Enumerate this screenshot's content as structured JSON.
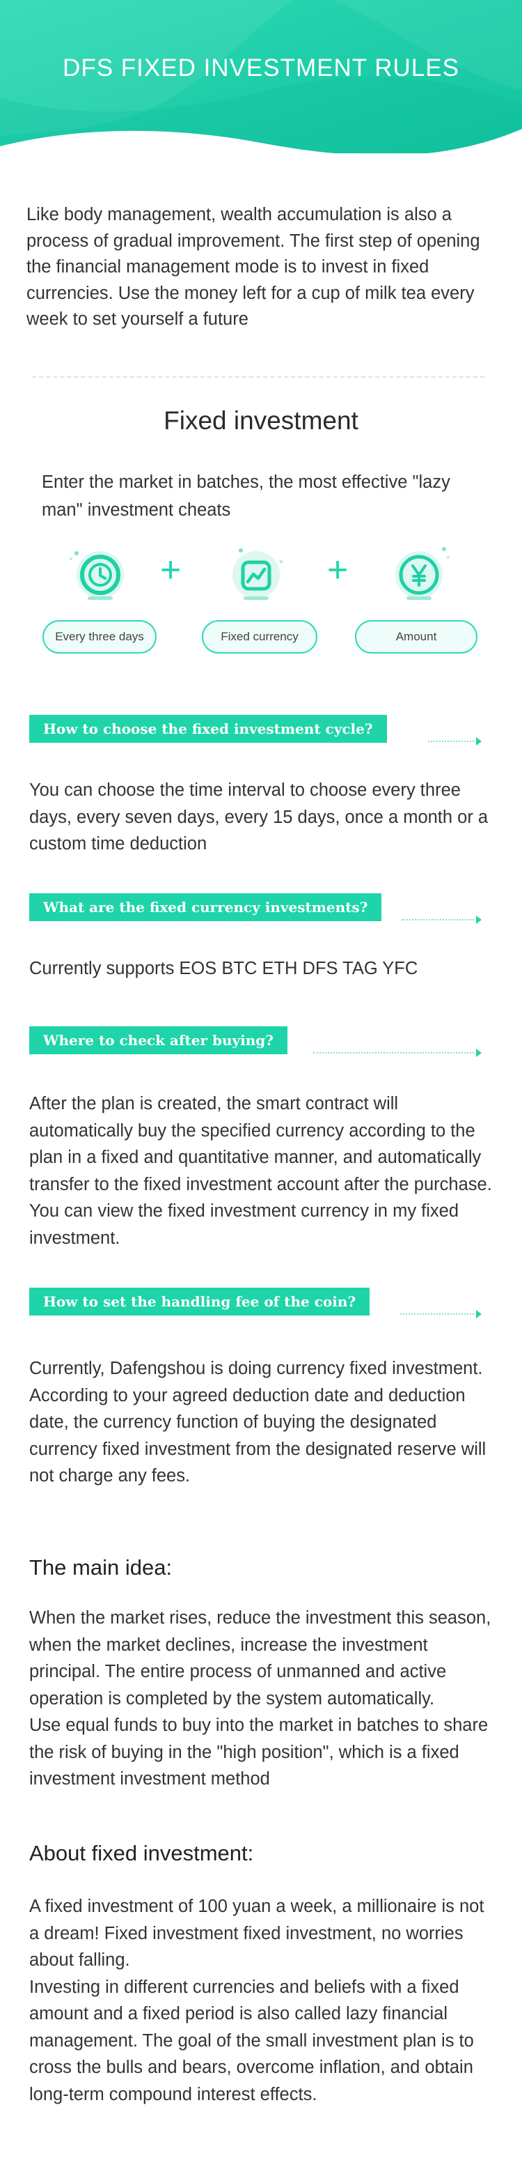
{
  "header": {
    "title": "DFS FIXED INVESTMENT RULES",
    "colors": {
      "gradient_start": "#2cd9b3",
      "gradient_end": "#14c4a1"
    }
  },
  "intro": "Like body management, wealth accumulation is also a process of gradual improvement. The first step of opening the financial management mode is to invest in fixed currencies. Use the money left for a cup of milk tea every week to set yourself a future",
  "fixed_investment": {
    "title": "Fixed investment",
    "subtitle": "Enter the market in batches, the most effective \"lazy man\" investment cheats",
    "steps": [
      {
        "icon": "clock-icon",
        "label": "Every three days"
      },
      {
        "icon": "chart-icon",
        "label": "Fixed currency"
      },
      {
        "icon": "yen-coin-icon",
        "label": "Amount"
      }
    ]
  },
  "questions": [
    {
      "q": "How to choose the fixed investment cycle?",
      "a": "You can choose the time interval to choose every three days, every seven days, every 15 days, once a month or a custom time deduction"
    },
    {
      "q": "What are the fixed currency investments?",
      "a": "Currently supports EOS BTC ETH DFS TAG YFC"
    },
    {
      "q": "Where to check after buying?",
      "a": "After the plan is created, the smart contract will automatically buy the specified currency according to the plan in a fixed and quantitative manner, and automatically transfer to the fixed investment account after the purchase. You can view the fixed investment currency in my fixed investment."
    },
    {
      "q": "How to set the handling fee of the coin?",
      "a": "Currently, Dafengshou is doing currency fixed investment. According to your agreed deduction date and deduction date, the currency function of buying the designated currency fixed investment from the designated reserve will not charge any fees."
    }
  ],
  "main_idea": {
    "title": "The main idea:",
    "text": "When the market rises, reduce the investment this season, when the market declines, increase the investment principal. The entire process of unmanned and active operation is completed by the system automatically.\nUse equal funds to buy into the market in batches to share the risk of buying in the \"high position\", which is a fixed investment investment method"
  },
  "about": {
    "title": "About fixed investment:",
    "text": "A fixed investment of 100 yuan a week, a millionaire is not a dream! Fixed investment fixed investment, no worries about falling.\nInvesting in different currencies and beliefs with a fixed amount and a fixed period is also called lazy financial management. The goal of the small investment plan is to cross the bulls and bears, overcome inflation, and obtain long-term compound interest effects."
  },
  "theme": {
    "accent": "#1ed4a8",
    "text": "#333333"
  }
}
